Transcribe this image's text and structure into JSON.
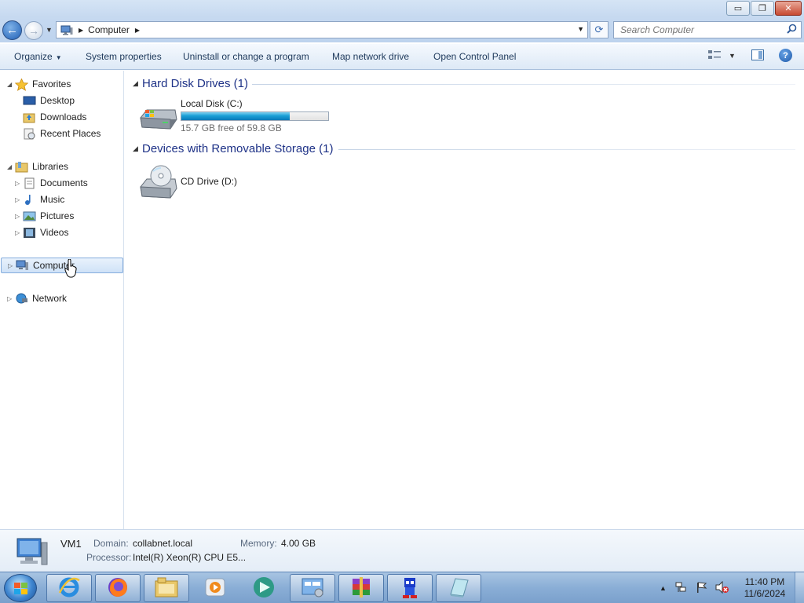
{
  "window": {
    "min_glyph": "▭",
    "max_glyph": "❐",
    "close_glyph": "✕"
  },
  "address": {
    "back_glyph": "←",
    "forward_glyph": "→",
    "crumb": "Computer",
    "crumb_sep": "▶",
    "dropdown_glyph": "▼",
    "refresh_glyph": "⟳"
  },
  "search": {
    "placeholder": "Search Computer"
  },
  "toolbar": {
    "organize": "Organize",
    "system_properties": "System properties",
    "uninstall": "Uninstall or change a program",
    "map_network_drive": "Map network drive",
    "open_control_panel": "Open Control Panel",
    "help_glyph": "?"
  },
  "nav": {
    "favorites": "Favorites",
    "desktop": "Desktop",
    "downloads": "Downloads",
    "recent_places": "Recent Places",
    "libraries": "Libraries",
    "documents": "Documents",
    "music": "Music",
    "pictures": "Pictures",
    "videos": "Videos",
    "computer": "Computer",
    "network": "Network",
    "expanded_glyph": "◢",
    "collapsed_glyph": "▷"
  },
  "content": {
    "group_hdd": "Hard Disk Drives (1)",
    "group_removable": "Devices with Removable Storage (1)",
    "drive_c": {
      "name": "Local Disk (C:)",
      "free_text": "15.7 GB free of 59.8 GB",
      "used_fraction": 0.737
    },
    "drive_d": {
      "name": "CD Drive (D:)"
    }
  },
  "details": {
    "computer_name": "VM1",
    "domain_label": "Domain:",
    "domain_value": "collabnet.local",
    "memory_label": "Memory:",
    "memory_value": "4.00 GB",
    "processor_label": "Processor:",
    "processor_value": "Intel(R) Xeon(R) CPU E5..."
  },
  "taskbar": {
    "tray_arrow": "▲",
    "time": "11:40 PM",
    "date": "11/6/2024"
  },
  "colors": {
    "group_title": "#1e3287",
    "drive_bar_fill": "#1a9fd6",
    "accent": "#3b6ea5"
  }
}
